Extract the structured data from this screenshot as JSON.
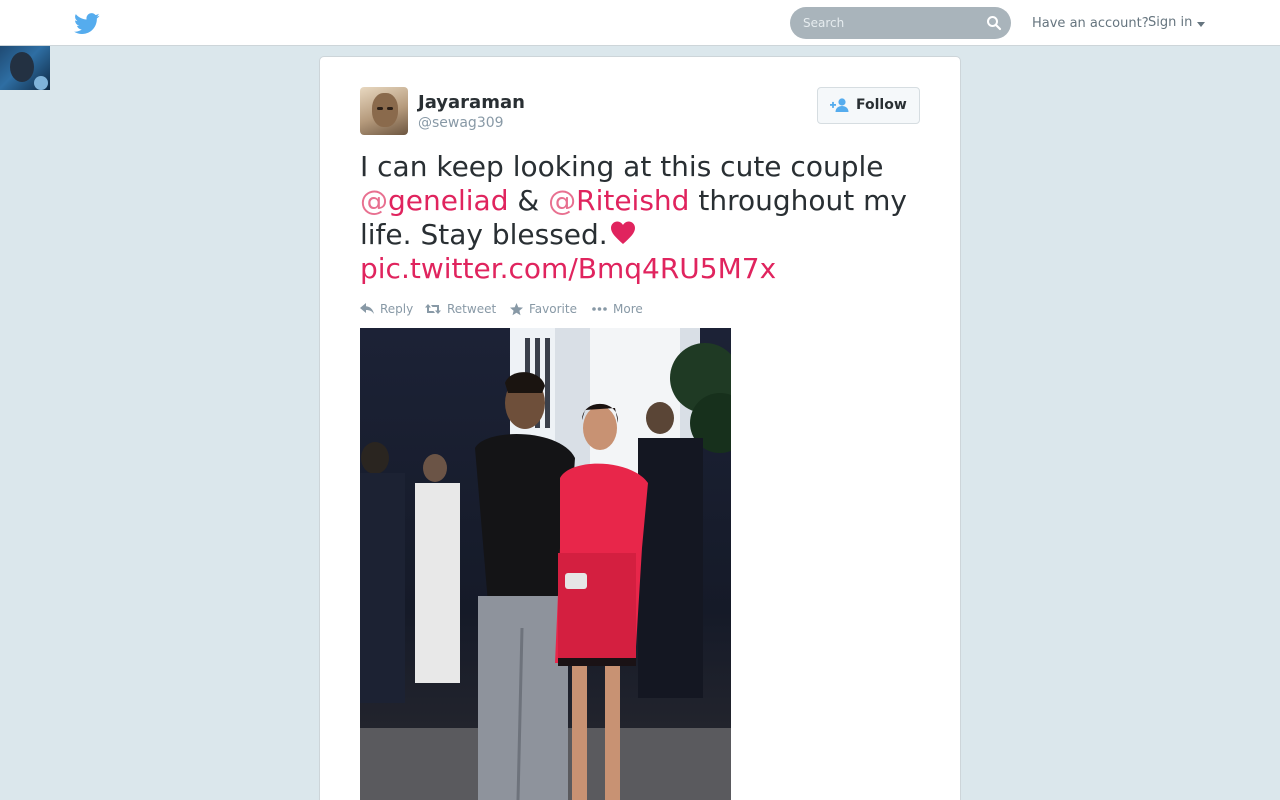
{
  "topbar": {
    "search_placeholder": "Search",
    "have_account": "Have an account?",
    "sign_in": "Sign in"
  },
  "tweet": {
    "display_name": "Jayaraman",
    "handle": "@sewag309",
    "follow_label": "Follow",
    "text_part1": "I can keep looking at this cute couple ",
    "mention1": "geneliad",
    "text_part2": " & ",
    "mention2": "Riteishd",
    "text_part3": " throughout my life. Stay blessed.",
    "pic_link": "pic.twitter.com/Bmq4RU5M7x"
  },
  "actions": {
    "reply": "Reply",
    "retweet": "Retweet",
    "favorite": "Favorite",
    "more": "More"
  },
  "colors": {
    "brand": "#55acee",
    "link": "#e0245e",
    "background": "#dbe7ec"
  }
}
